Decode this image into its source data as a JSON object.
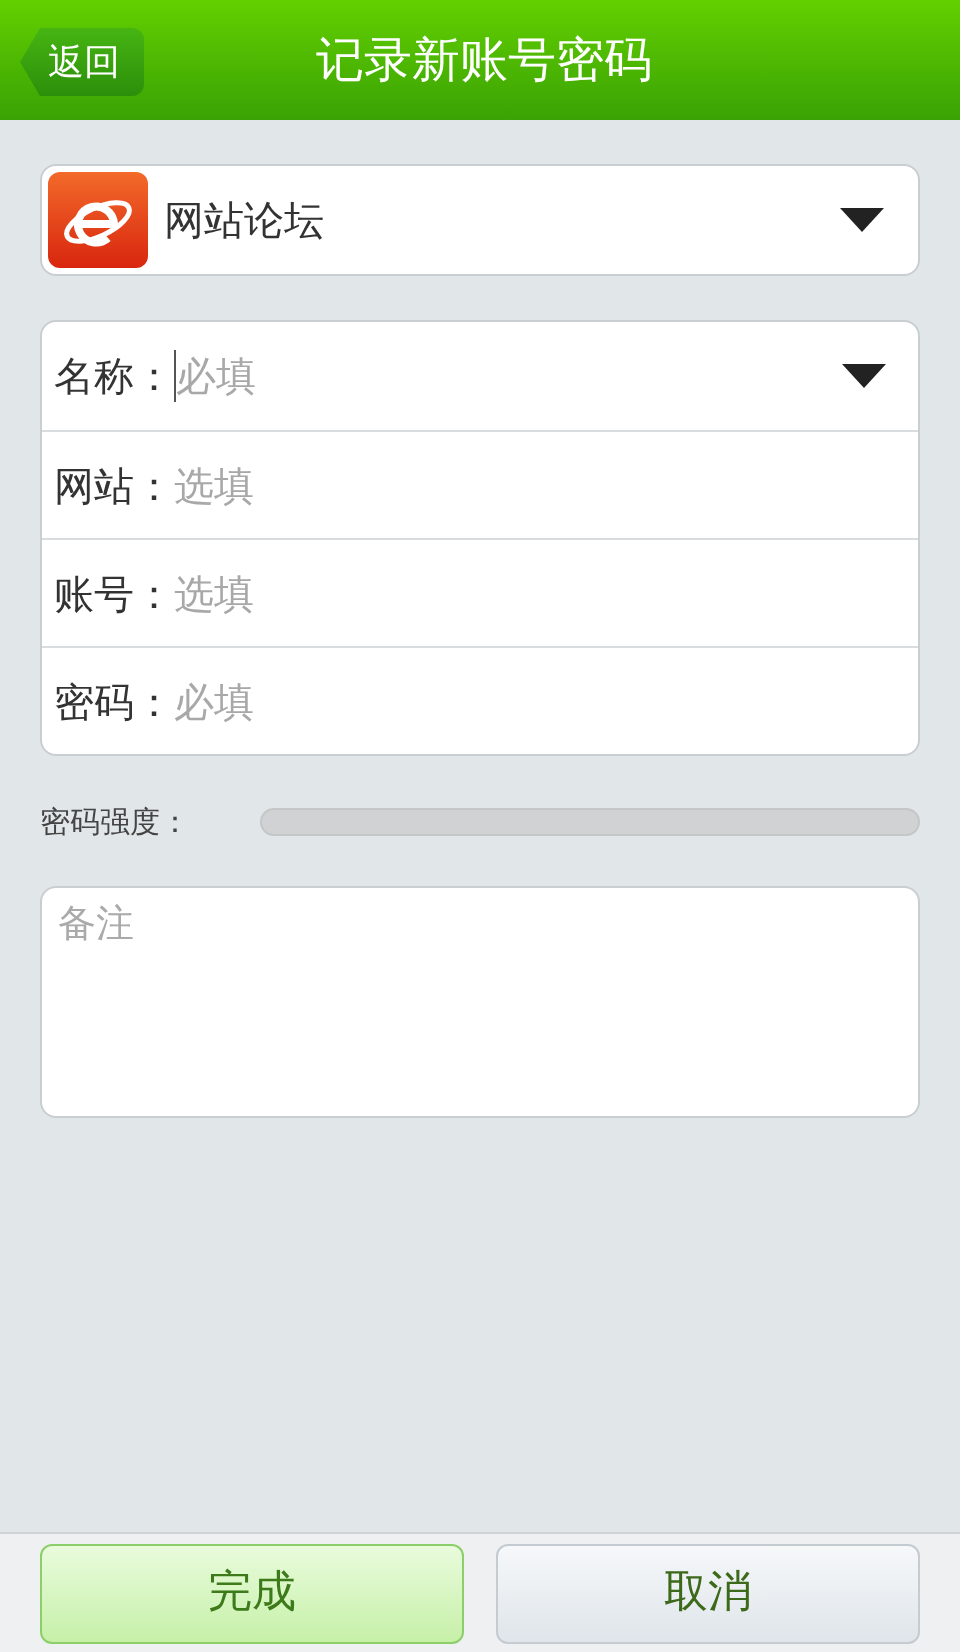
{
  "header": {
    "back_button": "返回",
    "title": "记录新账号密码"
  },
  "category": {
    "label": "网站论坛"
  },
  "fields": [
    {
      "label": "名称：",
      "placeholder": "必填",
      "has_dropdown": true,
      "focused": true
    },
    {
      "label": "网站：",
      "placeholder": "选填",
      "has_dropdown": false,
      "focused": false
    },
    {
      "label": "账号：",
      "placeholder": "选填",
      "has_dropdown": false,
      "focused": false
    },
    {
      "label": "密码：",
      "placeholder": "必填",
      "has_dropdown": false,
      "focused": false
    }
  ],
  "strength": {
    "label": "密码强度：",
    "level": 0
  },
  "notes": {
    "placeholder": "备注"
  },
  "buttons": [
    {
      "label": "完成",
      "kind": "primary"
    },
    {
      "label": "取消",
      "kind": "secondary"
    }
  ]
}
